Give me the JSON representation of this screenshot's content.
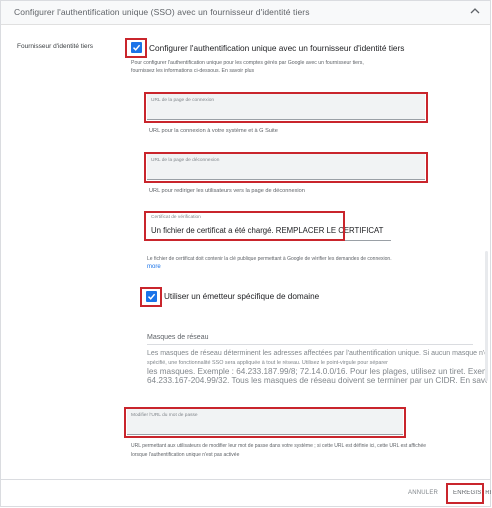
{
  "header": {
    "title": "Configurer l'authentification unique (SSO) avec un fournisseur d'identité tiers"
  },
  "section_label": "Fournisseur d'identité tiers",
  "sso_toggle": {
    "label": "Configurer l'authentification unique avec un fournisseur d'identité tiers",
    "checked": true,
    "help_line1": "Pour configurer l'authentification unique pour les comptes gérés par Google avec un fournisseur tiers,",
    "help_line2": "fournissez les informations ci-dessous. En savoir plus"
  },
  "login_url": {
    "label": "URL de la page de connexion",
    "value": "",
    "help": "URL pour la connexion à votre système et à G Suite"
  },
  "logout_url": {
    "label": "URL de la page de déconnexion",
    "value": "",
    "help": "URL pour rediriger les utilisateurs vers la page de déconnexion"
  },
  "certificate": {
    "label": "Certificat de vérification",
    "value": "Un fichier de certificat a été chargé. REMPLACER LE CERTIFICAT",
    "help": "Le fichier de certificat doit contenir la clé publique permettant à Google de vérifier les demandes de connexion.",
    "more": "more"
  },
  "domain_issuer": {
    "label": "Utiliser un émetteur spécifique de domaine",
    "checked": true
  },
  "netmasks": {
    "heading": "Masques de réseau",
    "lines": [
      "Les masques de réseau déterminent les adresses affectées par l'authentification unique. Si aucun masque n'est",
      "spécifié, une fonctionnalité SSO sera appliquée à tout le réseau. Utilisez le point-virgule pour séparer",
      "les masques. Exemple : 64.233.187.99/8; 72.14.0.0/16. Pour les plages, utilisez un tiret. Exemple :",
      "64.233.167-204.99/32. Tous les masques de réseau doivent se terminer par un CIDR. En savoir plus"
    ]
  },
  "change_password_url": {
    "label": "Modifier l'URL du mot de passe",
    "value": "",
    "help_line1": "URL permettant aux utilisateurs de modifier leur mot de passe dans votre système ; si cette URL est définie ici, cette URL est affichée",
    "help_line2": "lorsque l'authentification unique n'est pas activée"
  },
  "footer": {
    "cancel_label": "ANNULER",
    "save_label": "ENREGISTRER"
  },
  "colors": {
    "accent": "#1a73e8",
    "highlight": "#c9252c"
  }
}
